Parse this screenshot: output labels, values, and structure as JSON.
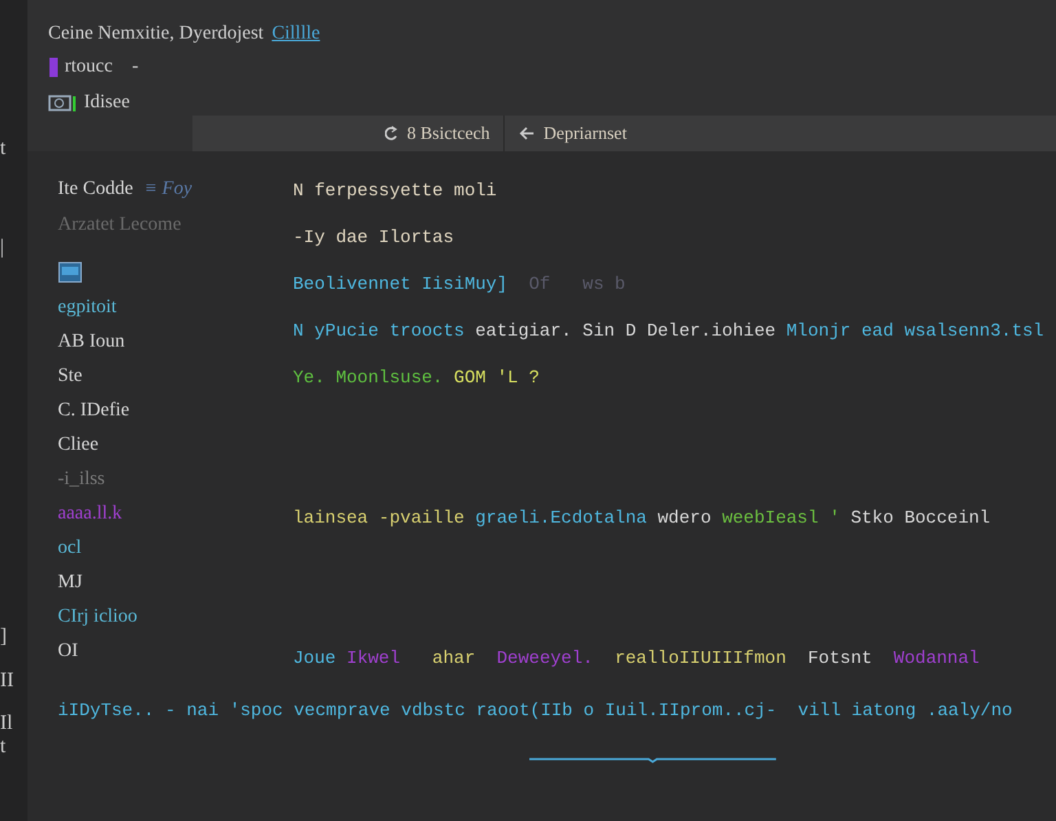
{
  "edge_marks": [
    "t",
    "|",
    "]",
    "II",
    "Il",
    "t"
  ],
  "header": {
    "title": "Ceine Nemxitie, Dyerdojest",
    "title_link": "Cilllle",
    "rows": [
      {
        "kind": "tag",
        "label": "rtoucc",
        "suffix": "-"
      },
      {
        "kind": "image",
        "label": "Idisee"
      }
    ]
  },
  "toolbar": {
    "buttons": [
      {
        "kind": "refresh",
        "label": "8 Bsictcech"
      },
      {
        "kind": "back",
        "label": "Depriarnset"
      }
    ]
  },
  "sidebar": {
    "heading": "Ite Codde",
    "heading_extra": "≡ Foy",
    "subheading": "Arzatet Lecome",
    "items": [
      {
        "kind": "icon"
      },
      {
        "kind": "text",
        "label": "egpitoit",
        "color": "#5ab8d6"
      },
      {
        "kind": "text",
        "label": "AB Ioun",
        "color": "#d6d6d6"
      },
      {
        "kind": "text",
        "label": "Ste",
        "color": "#d6d6d6"
      },
      {
        "kind": "text",
        "label": "C. IDefie",
        "color": "#d6d6d6"
      },
      {
        "kind": "text",
        "label": "Cliee",
        "color": "#d6d6d6"
      },
      {
        "kind": "text",
        "label": "-i_ilss",
        "color": "#7a7a7a"
      },
      {
        "kind": "text",
        "label": "aaaa.ll.k",
        "color": "#a040d0"
      },
      {
        "kind": "text",
        "label": "ocl",
        "color": "#5ab8d6"
      },
      {
        "kind": "text",
        "label": "MJ",
        "color": "#d6d6d6"
      },
      {
        "kind": "text",
        "label": "CIrj iclioo",
        "color": "#5ab8d6"
      },
      {
        "kind": "text",
        "label": "OI",
        "color": "#d6d6d6"
      }
    ]
  },
  "editor": {
    "blocks": [
      [
        [
          {
            "text": "N ferpessyette moli",
            "color": "#e0d6c0"
          }
        ],
        [
          {
            "text": "-Iy dae Ilortas",
            "color": "#e0d6c0"
          }
        ],
        [
          {
            "text": "Beolivennet IisiMuy]",
            "color": "#4fb8e0"
          },
          {
            "text": "  Of   ws b",
            "color": "#5a5a6a"
          }
        ],
        [
          {
            "text": "N yPucie troocts",
            "color": "#4fb8e0"
          },
          {
            "text": " eatigiar. Sin D Deler.iohiee",
            "color": "#d8d8d8"
          },
          {
            "text": " Mlonjr ead wsalsenn3.tsl",
            "color": "#4fb8e0"
          }
        ],
        [
          {
            "text": "Ye. Moonlsuse.",
            "color": "#5fc040"
          },
          {
            "text": " GOM 'L ?",
            "color": "#d8e060"
          }
        ]
      ],
      [
        [
          {
            "text": "lainsea -pvaille",
            "color": "#d8d070"
          },
          {
            "text": " graeli.Ecdotalna",
            "color": "#4fb8e0"
          },
          {
            "text": " wdero",
            "color": "#d8d8d8"
          },
          {
            "text": " weebIeasl '",
            "color": "#6cc040"
          },
          {
            "text": " Stko Bocceinl",
            "color": "#d8d8d8"
          }
        ]
      ],
      [
        [
          {
            "text": "Joue",
            "color": "#4fb8e0"
          },
          {
            "text": " Ikwel",
            "color": "#a040d0"
          },
          {
            "text": "   ahar",
            "color": "#d8d070"
          },
          {
            "text": "  Deweeyel.",
            "color": "#a040d0"
          },
          {
            "text": "  realloIIUIIIfmon",
            "color": "#d8d070"
          },
          {
            "text": "  Fotsnt",
            "color": "#d8d8d8"
          },
          {
            "text": "  Wodannal",
            "color": "#a040d0"
          }
        ]
      ]
    ]
  },
  "footer_line": [
    {
      "text": "iIDyTse.. - nai 'spoc vecmprave vdbstc raoot",
      "color": "#4fb8e0"
    },
    {
      "text": "(IIb o Iuil.IIprom..cj-",
      "color": "#4fb8e0",
      "underlined": true
    },
    {
      "text": "  vill iatong .aaly/no",
      "color": "#4fb8e0"
    }
  ]
}
